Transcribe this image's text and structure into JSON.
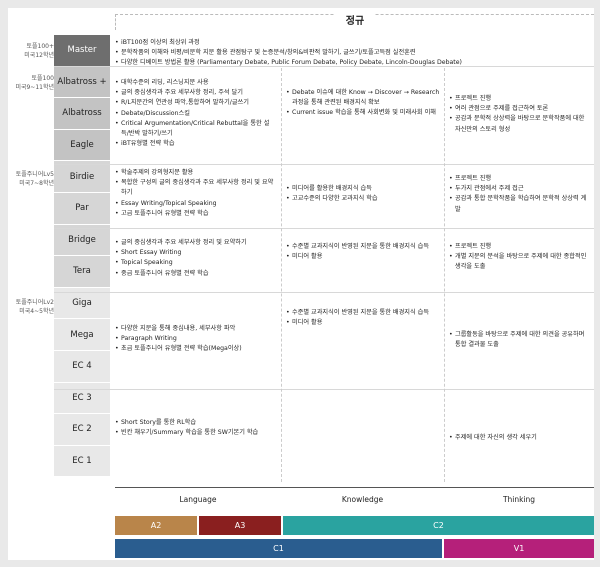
{
  "header": {
    "title": "정규"
  },
  "left_labels": {
    "g1": [
      "토플100+",
      "미국12학년"
    ],
    "g2": [
      "토플100",
      "미국9~11학년"
    ],
    "g3": [
      "토플주니어Lv5",
      "미국7~8학년"
    ],
    "g4": [
      "토플주니어Lv2",
      "미국4~5학년"
    ]
  },
  "levels": [
    "Master",
    "Albatross +",
    "Albatross",
    "Eagle",
    "Birdie",
    "Par",
    "Bridge",
    "Tera",
    "Giga",
    "Mega",
    "EC 4",
    "EC 3",
    "EC 2",
    "EC 1"
  ],
  "master": [
    "iBT100점 이상의 최상위 과정",
    "문학작품의 이해와 비평/비문학 지문 활용 관점탐구 및 논증분석/창의&비판적 말하기, 글쓰기/토플고득점 실전훈련",
    "다양한 디베이트 방법론 활용 (Parliamentary Debate, Public Forum Debate, Policy Debate, Lincoln-Douglas Debate)"
  ],
  "albatross": {
    "language": [
      "대학수준의 리딩, 리스닝지문 사용",
      "글의 중심생각과 주요 세부사항 정리, 주석 달기",
      "R/L지문간의 연관성 파악,통합하여 말하기/글쓰기",
      "Debate/Discussion스킬",
      "Critical Argumentation/Critical Rebuttal을 통한 설득/반박 말하기/쓰기",
      "iBT유형별 전략 학습"
    ],
    "knowledge": [
      "Debate 이슈에 대한 Know → Discover → Research 과정을 통해 관련된 배경지식 확보",
      "Current issue 학습을 통해 사회변화 및 미래사회 이해"
    ],
    "thinking": [
      "프로젝트 진행",
      "여러 관점으로 주제를 접근하여 토론",
      "공감과 문학적 상상력을 바탕으로 문학작품에 대한 자신만의 스토리 형성"
    ]
  },
  "birdie": {
    "language": [
      "학술주제의 강의형지문 활용",
      "복합한 구성의 글의 중심생각과 주요 세부사항 정리 및 요약하기",
      "Essay Writing/Topical Speaking",
      "고급 토플주니어 유형별 전략 학습"
    ],
    "knowledge": [
      "미디어를 활용한 배경지식 습득",
      "고교수준의 다양한 교과지식 학습"
    ],
    "thinking": [
      "프로젝트 진행",
      "두가지 관점에서 주제 접근",
      "공감과 통합 문학작품을 학습하여 문학적 상상력 계발"
    ]
  },
  "bridge": {
    "language": [
      "글의 중심생각과 주요 세부사항 정리 및 요약하기",
      "Short Essay Writing",
      "Topical Speaking",
      "중급 토플주니어 유형별 전략 학습"
    ],
    "knowledge": [
      "수준별 교과지식이 반영된 지문을 통한 배경지식 습득",
      "미디어 활용"
    ],
    "thinking": [
      "프로젝트 진행",
      "개별 지문의 분석을 바탕으로 주제에 대한 종합적인 생각을 도출"
    ]
  },
  "giga": {
    "language": [
      "다양한 지문을 통해 중심내용, 세부사항 파악",
      "Paragraph Writing",
      "초급 토플주니어 유형별 전략 학습(Mega이상)"
    ],
    "knowledge": [
      "수준별 교과지식이 반영된 지문을 통한 배경지식 습득",
      "미디어 활용"
    ],
    "thinking": [
      "그룹활동을 바탕으로 주제에 대한 의견을 공유하며 통합 결과물 도출"
    ]
  },
  "ec": {
    "language": [
      "Short Story를 통한 RL학습",
      "빈칸 채우기/Summary 학습을 통한 SW기본기 학습"
    ],
    "thinking": [
      "주제에 대한 자신의 생각 세우기"
    ]
  },
  "footer": {
    "labels": [
      "Language",
      "Knowledge",
      "Thinking"
    ],
    "bars": [
      "A2",
      "A3",
      "C2",
      "C1",
      "V1"
    ],
    "colors": {
      "A2": "#b9854a",
      "A3": "#8a1f1f",
      "C2": "#2aa3a0",
      "C1": "#2a5d8f",
      "V1": "#b5207a"
    }
  }
}
